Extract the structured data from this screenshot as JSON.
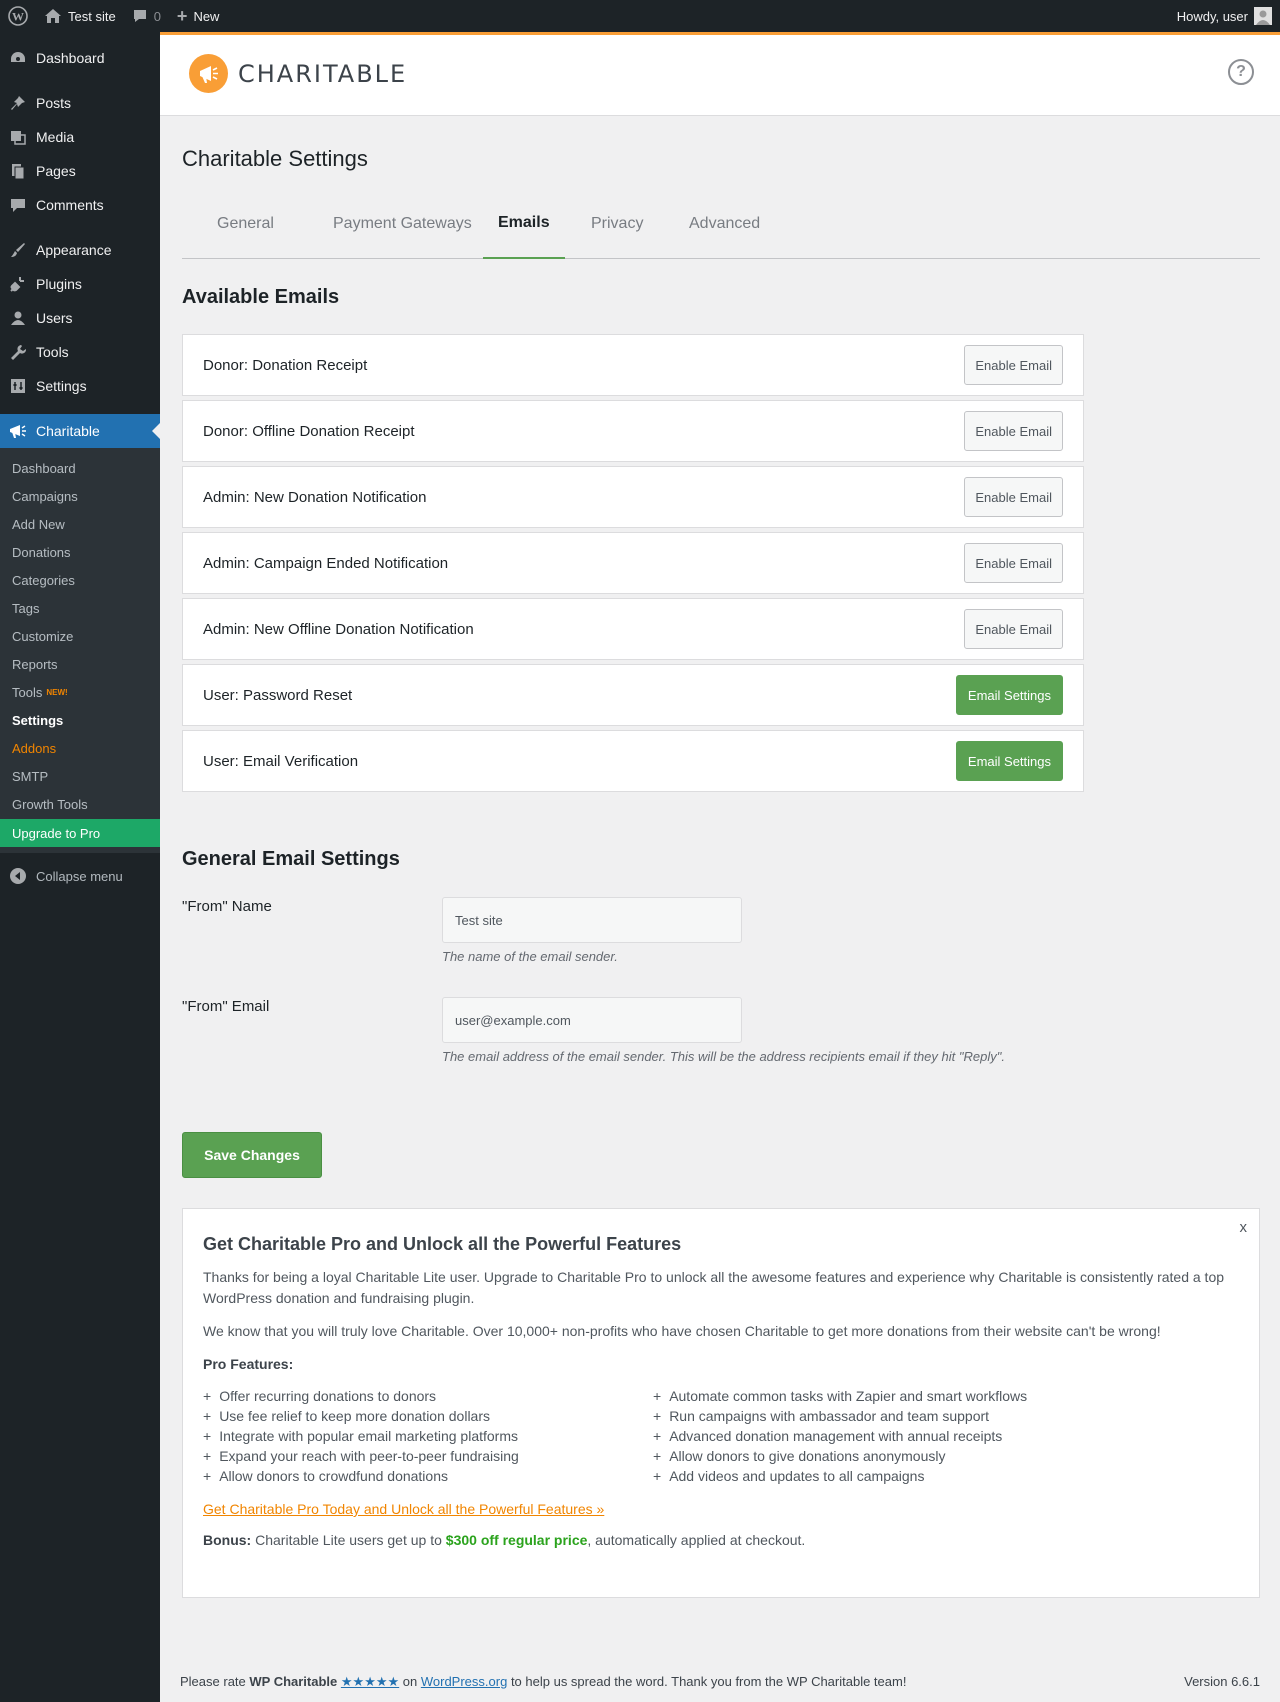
{
  "adminbar": {
    "site_name": "Test site",
    "comments_count": "0",
    "new_label": "New",
    "howdy": "Howdy, user"
  },
  "sidebar": {
    "items": [
      {
        "label": "Dashboard",
        "icon": "dashboard-icon"
      },
      {
        "label": "Posts",
        "icon": "pin-icon"
      },
      {
        "label": "Media",
        "icon": "media-icon"
      },
      {
        "label": "Pages",
        "icon": "pages-icon"
      },
      {
        "label": "Comments",
        "icon": "comments-icon"
      },
      {
        "label": "Appearance",
        "icon": "brush-icon"
      },
      {
        "label": "Plugins",
        "icon": "plug-icon"
      },
      {
        "label": "Users",
        "icon": "users-icon"
      },
      {
        "label": "Tools",
        "icon": "wrench-icon"
      },
      {
        "label": "Settings",
        "icon": "settings-icon"
      },
      {
        "label": "Charitable",
        "icon": "megaphone-icon"
      }
    ],
    "submenu": [
      "Dashboard",
      "Campaigns",
      "Add New",
      "Donations",
      "Categories",
      "Tags",
      "Customize",
      "Reports",
      "Tools",
      "Settings",
      "Addons",
      "SMTP",
      "Growth Tools",
      "Upgrade to Pro"
    ],
    "tools_badge": "NEW!",
    "collapse": "Collapse menu"
  },
  "header": {
    "logo_text": "CHARITABLE",
    "help": "?"
  },
  "page": {
    "title": "Charitable Settings",
    "tabs": [
      "General",
      "Payment Gateways",
      "Emails",
      "Privacy",
      "Advanced"
    ],
    "active_tab": "Emails"
  },
  "emails": {
    "heading": "Available Emails",
    "rows": [
      {
        "name": "Donor: Donation Receipt",
        "action": "Enable Email"
      },
      {
        "name": "Donor: Offline Donation Receipt",
        "action": "Enable Email"
      },
      {
        "name": "Admin: New Donation Notification",
        "action": "Enable Email"
      },
      {
        "name": "Admin: Campaign Ended Notification",
        "action": "Enable Email"
      },
      {
        "name": "Admin: New Offline Donation Notification",
        "action": "Enable Email"
      },
      {
        "name": "User: Password Reset",
        "action": "Email Settings"
      },
      {
        "name": "User: Email Verification",
        "action": "Email Settings"
      }
    ]
  },
  "general": {
    "heading": "General Email Settings",
    "from_name_label": "\"From\" Name",
    "from_name_value": "Test site",
    "from_name_desc": "The name of the email sender.",
    "from_email_label": "\"From\" Email",
    "from_email_value": "user@example.com",
    "from_email_desc": "The email address of the email sender. This will be the address recipients email if they hit \"Reply\".",
    "save": "Save Changes"
  },
  "promo": {
    "close": "x",
    "title": "Get Charitable Pro and Unlock all the Powerful Features",
    "p1": "Thanks for being a loyal Charitable Lite user. Upgrade to Charitable Pro to unlock all the awesome features and experience why Charitable is consistently rated a top WordPress donation and fundraising plugin.",
    "p2": "We know that you will truly love Charitable. Over 10,000+ non-profits who have chosen Charitable to get more donations from their website can't be wrong!",
    "features_title": "Pro Features:",
    "features_left": [
      "Offer recurring donations to donors",
      "Use fee relief to keep more donation dollars",
      "Integrate with popular email marketing platforms",
      "Expand your reach with peer-to-peer fundraising",
      "Allow donors to crowdfund donations"
    ],
    "features_right": [
      "Automate common tasks with Zapier and smart workflows",
      "Run campaigns with ambassador and team support",
      "Advanced donation management with annual receipts",
      "Allow donors to give donations anonymously",
      "Add videos and updates to all campaigns"
    ],
    "link": "Get Charitable Pro Today and Unlock all the Powerful Features »",
    "bonus_label": "Bonus:",
    "bonus_pre": " Charitable Lite users get up to ",
    "bonus_amount": "$300 off regular price",
    "bonus_post": ", automatically applied at checkout."
  },
  "footer": {
    "rate_pre": "Please rate ",
    "rate_name": "WP Charitable",
    "rate_stars": "★★★★★",
    "rate_on": " on ",
    "rate_link": "WordPress.org",
    "rate_post": " to help us spread the word. Thank you from the WP Charitable team!",
    "version": "Version 6.6.1"
  },
  "colors": {
    "accent_green": "#5aa152",
    "brand_orange": "#f99e36",
    "wp_blue": "#2271b1"
  }
}
